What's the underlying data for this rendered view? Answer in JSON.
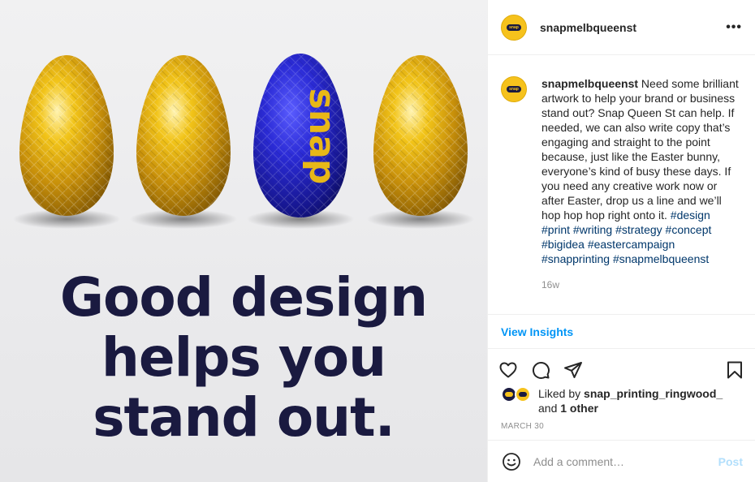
{
  "image": {
    "egg_label": "snap",
    "headline": [
      "Good design",
      "helps you",
      "stand out."
    ]
  },
  "header": {
    "avatar_label": "snap",
    "username": "snapmelbqueenst",
    "more_icon": "more-horizontal-icon"
  },
  "caption": {
    "username": "snapmelbqueenst",
    "text": "Need some brilliant artwork to help your brand or business stand out? Snap Queen St can help. If needed, we can also write copy that’s engaging and straight to the point because, just like the Easter bunny, everyone’s kind of busy these days. If you need any creative work now or after Easter, drop us a line and we’ll hop hop hop right onto it.",
    "hashtags": [
      "#design",
      "#print",
      "#writing",
      "#strategy",
      "#concept",
      "#bigidea",
      "#eastercampaign",
      "#snapprinting",
      "#snapmelbqueenst"
    ],
    "time_ago": "16w"
  },
  "insights": {
    "label": "View Insights"
  },
  "actions": {
    "icons": [
      "heart-icon",
      "comment-icon",
      "share-icon",
      "bookmark-icon"
    ]
  },
  "likes": {
    "prefix": "Liked by",
    "user": "snap_printing_ringwood_",
    "and": "and",
    "others": "1 other"
  },
  "date": "MARCH 30",
  "comment": {
    "placeholder": "Add a comment…",
    "post_label": "Post"
  },
  "colors": {
    "accent_blue": "#0095f6",
    "brand_yellow": "#f6c21c",
    "brand_navy": "#1a1a40",
    "hashtag_blue": "#00376b"
  }
}
